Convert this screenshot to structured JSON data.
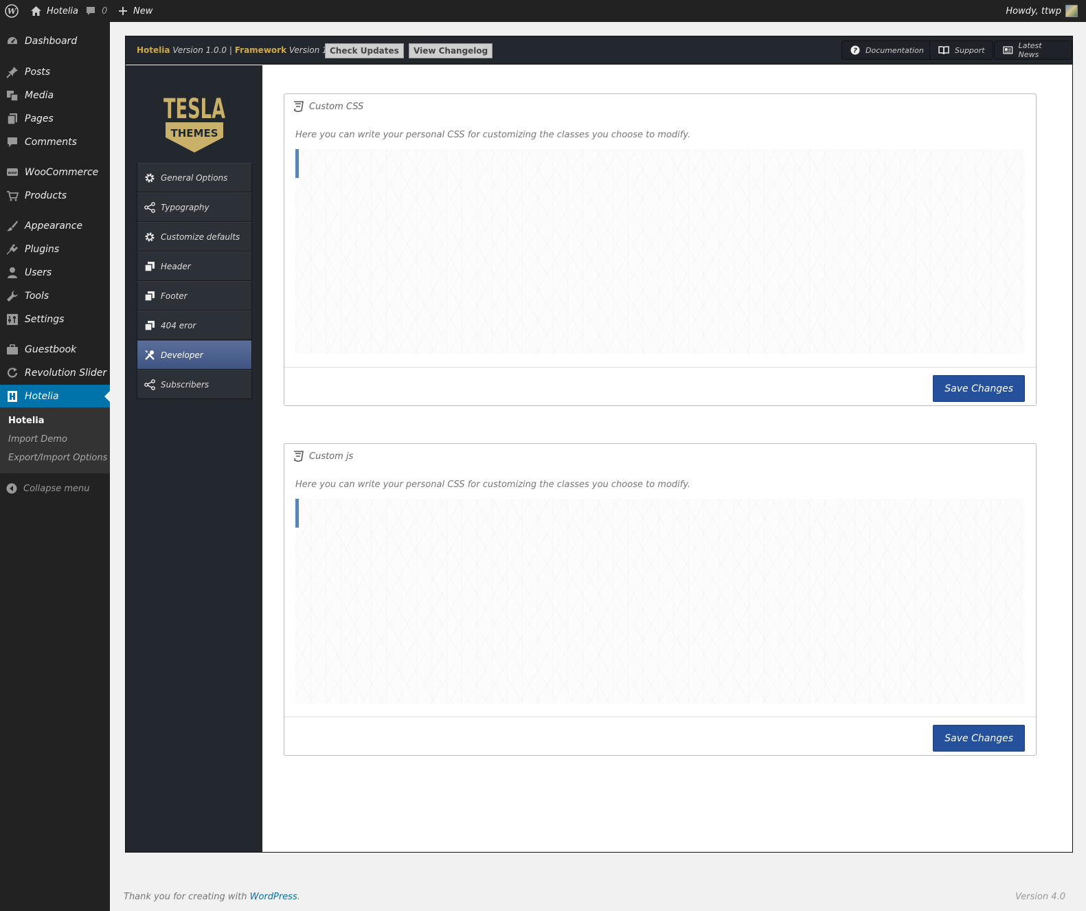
{
  "adminbar": {
    "site_name": "Hotelia",
    "comments_count": "0",
    "new_label": "New",
    "howdy": "Howdy, ttwp"
  },
  "menu": {
    "items": [
      {
        "label": "Dashboard",
        "icon": "dashboard-icon"
      },
      {
        "label": "Posts",
        "icon": "pin-icon"
      },
      {
        "label": "Media",
        "icon": "media-icon"
      },
      {
        "label": "Pages",
        "icon": "pages-icon"
      },
      {
        "label": "Comments",
        "icon": "comment-icon"
      },
      {
        "label": "WooCommerce",
        "icon": "woo-icon"
      },
      {
        "label": "Products",
        "icon": "cart-icon"
      },
      {
        "label": "Appearance",
        "icon": "brush-icon"
      },
      {
        "label": "Plugins",
        "icon": "plugin-icon"
      },
      {
        "label": "Users",
        "icon": "user-icon"
      },
      {
        "label": "Tools",
        "icon": "wrench-icon"
      },
      {
        "label": "Settings",
        "icon": "settings-icon"
      },
      {
        "label": "Guestbook",
        "icon": "briefcase-icon"
      },
      {
        "label": "Revolution Slider",
        "icon": "refresh-icon"
      },
      {
        "label": "Hotelia",
        "icon": "hotelia-icon"
      }
    ],
    "submenu": [
      "Hotelia",
      "Import Demo",
      "Export/Import Options"
    ],
    "collapse": "Collapse menu"
  },
  "tesla": {
    "theme_name": "Hotelia",
    "version_text": "Version 1.0.0",
    "separator": "|",
    "framework_label": "Framework",
    "framework_version": "Version 1.9",
    "check_updates": "Check Updates",
    "view_changelog": "View Changelog",
    "documentation": "Documentation",
    "support": "Support",
    "latest_news": "Latest News",
    "logo_top": "TESLA",
    "logo_bottom": "THEMES",
    "accent_color": "#d1a948",
    "nav": [
      {
        "label": "General Options",
        "icon": "gear-icon"
      },
      {
        "label": "Typography",
        "icon": "share-icon"
      },
      {
        "label": "Customize defaults",
        "icon": "gear-icon"
      },
      {
        "label": "Header",
        "icon": "copy-icon"
      },
      {
        "label": "Footer",
        "icon": "copy-icon"
      },
      {
        "label": "404 eror",
        "icon": "copy-icon"
      },
      {
        "label": "Developer",
        "icon": "tools-icon"
      },
      {
        "label": "Subscribers",
        "icon": "share-icon"
      }
    ],
    "active_nav": "Developer"
  },
  "boxes": [
    {
      "title": "Custom CSS",
      "description": "Here you can write your personal CSS for customizing the classes you choose to modify.",
      "save_label": "Save Changes"
    },
    {
      "title": "Custom js",
      "description": "Here you can write your personal CSS for customizing the classes you choose to modify.",
      "save_label": "Save Changes"
    }
  ],
  "footer": {
    "thanks_prefix": "Thank you for creating with",
    "wordpress_link": "WordPress",
    "thanks_suffix": ".",
    "version": "Version 4.0"
  }
}
